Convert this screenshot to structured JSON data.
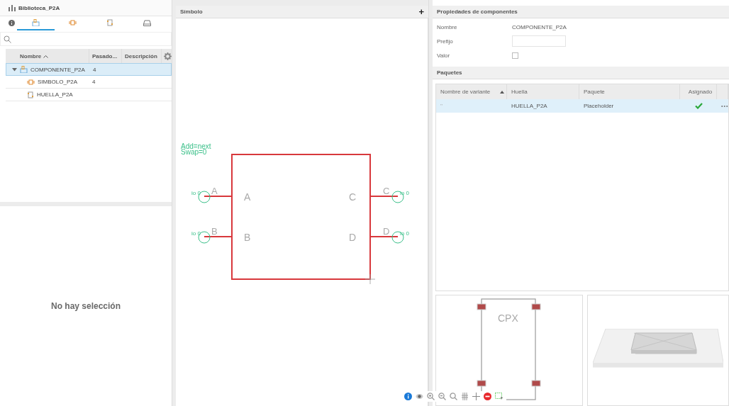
{
  "library": {
    "title": "Biblioteca_P2A",
    "tabs": [
      {
        "kind": "info",
        "selected": false
      },
      {
        "kind": "component",
        "selected": true
      },
      {
        "kind": "symbol",
        "selected": false
      },
      {
        "kind": "footprint",
        "selected": false
      },
      {
        "kind": "package",
        "selected": false
      }
    ],
    "columns": [
      {
        "label": "Nombre",
        "sorted": true
      },
      {
        "label": "Pasado...",
        "sorted": false
      },
      {
        "label": "Descripción",
        "sorted": false
      }
    ],
    "tree": [
      {
        "kind": "component",
        "name": "COMPONENTE_P2A",
        "count": "4",
        "selected": true,
        "expanded": true,
        "children": [
          {
            "kind": "symbol",
            "name": "SIMBOLO_P2A",
            "count": "4",
            "selected": false
          },
          {
            "kind": "footprint",
            "name": "HUELLA_P2A",
            "selected": false
          }
        ]
      }
    ],
    "empty_message": "No hay selección"
  },
  "symbol": {
    "title": "Símbolo",
    "add": "+",
    "attributes": [
      "Add=next",
      "Swap=0"
    ],
    "left_pins": [
      {
        "outer_label": "A",
        "inner_label": "A",
        "io": "io 0"
      },
      {
        "outer_label": "B",
        "inner_label": "B",
        "io": "io 0"
      }
    ],
    "right_pins": [
      {
        "outer_label": "C",
        "inner_label": "C",
        "io": "io 0"
      },
      {
        "outer_label": "D",
        "inner_label": "D",
        "io": "io 0"
      }
    ]
  },
  "properties": {
    "title": "Propiedades de componentes",
    "fields": [
      {
        "kind": "text",
        "label": "Nombre",
        "value": "COMPONENTE_P2A"
      },
      {
        "kind": "input",
        "label": "Prefijo"
      },
      {
        "kind": "checkbox",
        "label": "Valor",
        "checked": false
      }
    ]
  },
  "packages": {
    "title": "Paquetes",
    "columns": [
      "Nombre de variante",
      "Huella",
      "Paquete",
      "Asignado"
    ],
    "rows": [
      {
        "variant": "''",
        "footprint": "HUELLA_P2A",
        "package": "Placeholder",
        "assigned": true,
        "selected": true,
        "more": "•••"
      }
    ],
    "footprint_label": "CPX"
  }
}
